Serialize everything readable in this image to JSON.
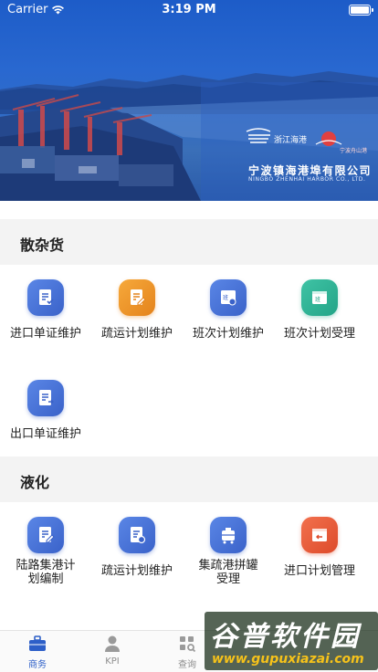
{
  "status_bar": {
    "carrier": "Carrier",
    "time": "3:19 PM"
  },
  "banner": {
    "brand_zj": "浙江海港",
    "brand_nb": "宁波舟山港",
    "company_cn": "宁波镇海港埠有限公司",
    "company_en": "NINGBO ZHENHAI HARBOR CO., LTD."
  },
  "sections": [
    {
      "title": "散杂货",
      "items": [
        {
          "label": "进口单证维护",
          "icon": "document-check-icon",
          "color": "#3a62c9"
        },
        {
          "label": "疏运计划维护",
          "icon": "document-edit-icon",
          "color": "#e4831c"
        },
        {
          "label": "班次计划维护",
          "icon": "shift-gear-icon",
          "color": "#3a62c9"
        },
        {
          "label": "班次计划受理",
          "icon": "shift-calendar-icon",
          "color": "#23a487"
        },
        {
          "label": "出口单证维护",
          "icon": "document-export-icon",
          "color": "#3a62c9"
        }
      ]
    },
    {
      "title": "液化",
      "items": [
        {
          "label": "陆路集港计划编制",
          "icon": "document-edit-icon",
          "color": "#3a62c9"
        },
        {
          "label": "疏运计划维护",
          "icon": "document-gear-icon",
          "color": "#3a62c9"
        },
        {
          "label": "集疏港拼罐受理",
          "icon": "tank-icon",
          "color": "#3a62c9"
        },
        {
          "label": "进口计划管理",
          "icon": "calendar-return-icon",
          "color": "#dd4a2a"
        }
      ]
    }
  ],
  "tab_bar": {
    "tabs": [
      {
        "label": "商务",
        "icon": "briefcase-icon",
        "active": true
      },
      {
        "label": "KPI",
        "icon": "person-icon",
        "active": false
      },
      {
        "label": "查询",
        "icon": "search-grid-icon",
        "active": false
      }
    ]
  },
  "watermark": {
    "title": "谷普软件园",
    "url": "www.gupuxiazai.com"
  }
}
